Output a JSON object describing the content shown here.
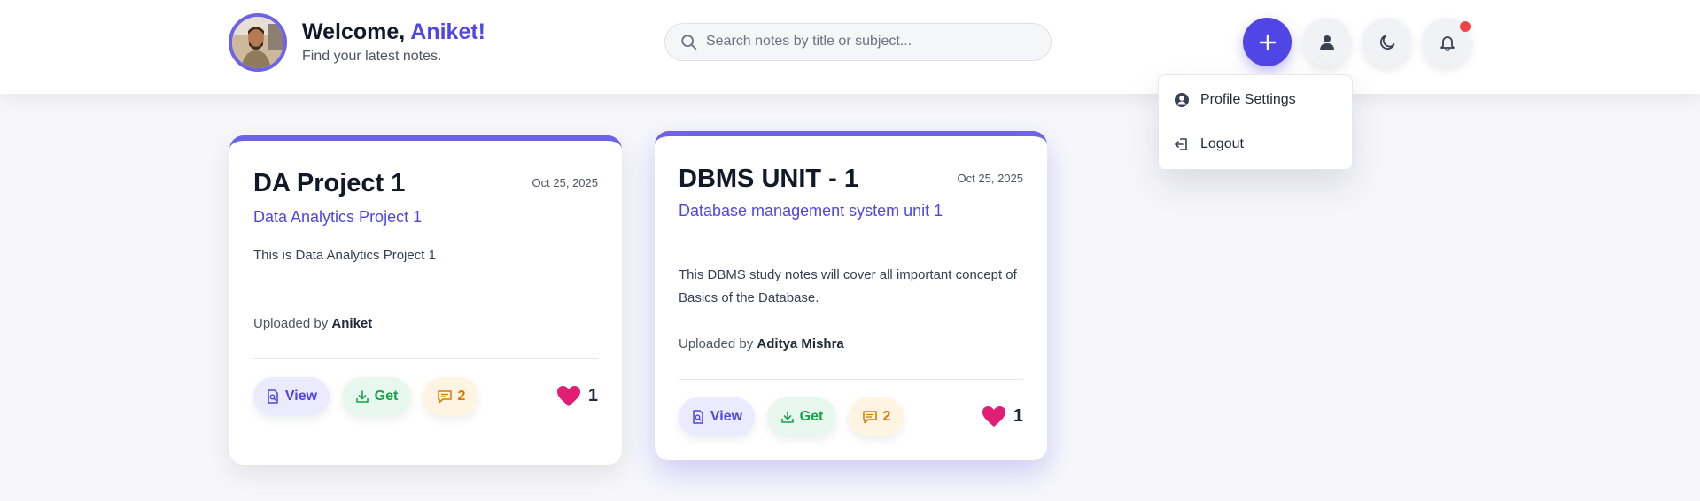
{
  "header": {
    "welcome_prefix": "Welcome, ",
    "user_name": "Aniket!",
    "subtitle": "Find your latest notes."
  },
  "search": {
    "placeholder": "Search notes by title or subject...",
    "value": ""
  },
  "toolbar": {
    "add_icon": "plus-icon",
    "profile_icon": "user-icon",
    "theme_icon": "moon-icon",
    "notifications_icon": "bell-icon",
    "has_notification": true
  },
  "dropdown": {
    "items": [
      {
        "label": "Profile Settings",
        "icon": "user-circle-icon"
      },
      {
        "label": "Logout",
        "icon": "logout-icon"
      }
    ]
  },
  "notes": [
    {
      "title": "DA Project 1",
      "date": "Oct 25, 2025",
      "subject": "Data Analytics Project 1",
      "description": "This is Data Analytics Project 1",
      "uploaded_by_label": "Uploaded by ",
      "uploader": "Aniket",
      "view_label": "View",
      "get_label": "Get",
      "comments": "2",
      "likes": "1"
    },
    {
      "title": "DBMS UNIT - 1",
      "date": "Oct 25, 2025",
      "subject": "Database management system unit 1",
      "description": "This DBMS study notes will cover all important concept of Basics of the Database.",
      "uploaded_by_label": "Uploaded by ",
      "uploader": "Aditya Mishra",
      "view_label": "View",
      "get_label": "Get",
      "comments": "2",
      "likes": "1"
    }
  ],
  "colors": {
    "accent": "#4f46e5",
    "get": "#16a34a",
    "comments": "#d97706",
    "like": "#e11d74",
    "notification": "#ef4444"
  }
}
